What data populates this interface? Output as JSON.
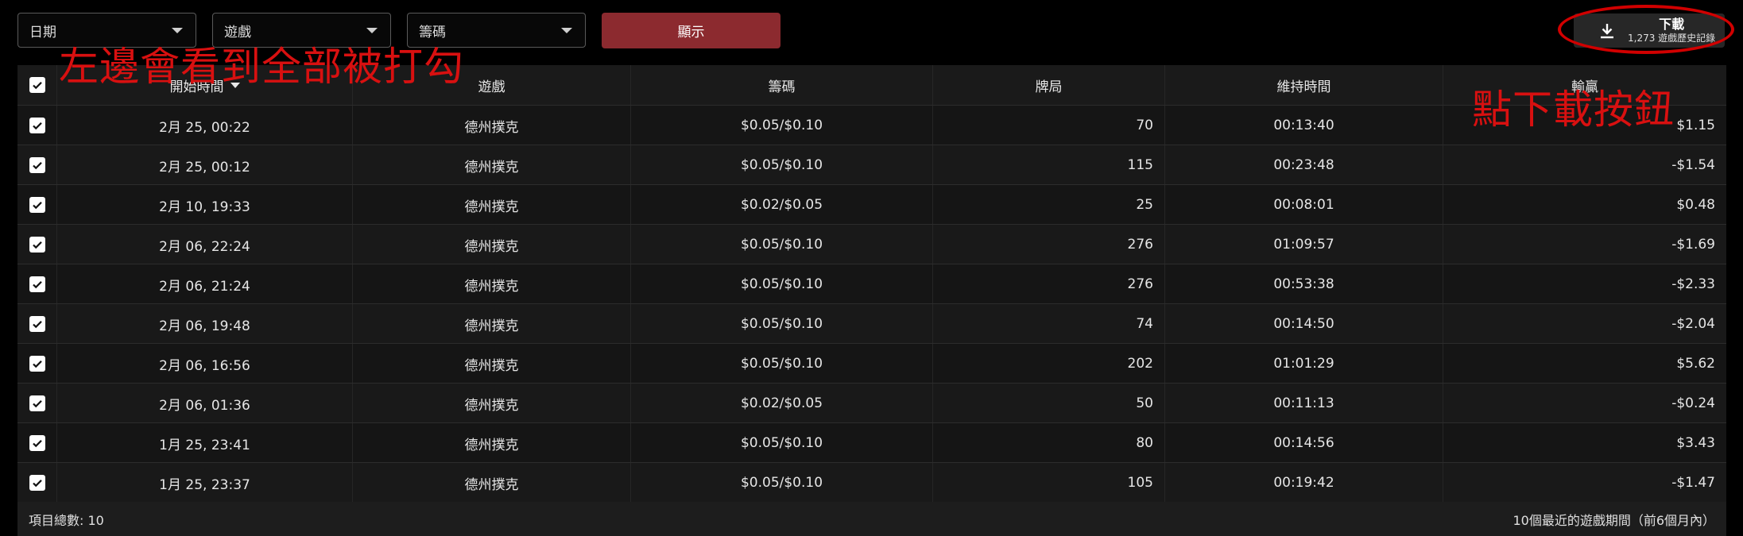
{
  "filters": {
    "date_label": "日期",
    "game_label": "遊戲",
    "stakes_label": "籌碼",
    "show_button": "顯示"
  },
  "download": {
    "title": "下載",
    "subtitle": "1,273 遊戲歷史記錄"
  },
  "annotations": {
    "left": "左邊會看到全部被打勾",
    "right": "點下載按鈕"
  },
  "table": {
    "headers": {
      "start_time": "開始時間",
      "game": "遊戲",
      "stakes": "籌碼",
      "hands": "牌局",
      "duration": "維持時間",
      "win_loss": "輸贏"
    },
    "rows": [
      {
        "start_time": "2月 25, 00:22",
        "game": "德州撲克",
        "stakes": "$0.05/$0.10",
        "hands": "70",
        "duration": "00:13:40",
        "win_loss": "$1.15"
      },
      {
        "start_time": "2月 25, 00:12",
        "game": "德州撲克",
        "stakes": "$0.05/$0.10",
        "hands": "115",
        "duration": "00:23:48",
        "win_loss": "-$1.54"
      },
      {
        "start_time": "2月 10, 19:33",
        "game": "德州撲克",
        "stakes": "$0.02/$0.05",
        "hands": "25",
        "duration": "00:08:01",
        "win_loss": "$0.48"
      },
      {
        "start_time": "2月 06, 22:24",
        "game": "德州撲克",
        "stakes": "$0.05/$0.10",
        "hands": "276",
        "duration": "01:09:57",
        "win_loss": "-$1.69"
      },
      {
        "start_time": "2月 06, 21:24",
        "game": "德州撲克",
        "stakes": "$0.05/$0.10",
        "hands": "276",
        "duration": "00:53:38",
        "win_loss": "-$2.33"
      },
      {
        "start_time": "2月 06, 19:48",
        "game": "德州撲克",
        "stakes": "$0.05/$0.10",
        "hands": "74",
        "duration": "00:14:50",
        "win_loss": "-$2.04"
      },
      {
        "start_time": "2月 06, 16:56",
        "game": "德州撲克",
        "stakes": "$0.05/$0.10",
        "hands": "202",
        "duration": "01:01:29",
        "win_loss": "$5.62"
      },
      {
        "start_time": "2月 06, 01:36",
        "game": "德州撲克",
        "stakes": "$0.02/$0.05",
        "hands": "50",
        "duration": "00:11:13",
        "win_loss": "-$0.24"
      },
      {
        "start_time": "1月 25, 23:41",
        "game": "德州撲克",
        "stakes": "$0.05/$0.10",
        "hands": "80",
        "duration": "00:14:56",
        "win_loss": "$3.43"
      },
      {
        "start_time": "1月 25, 23:37",
        "game": "德州撲克",
        "stakes": "$0.05/$0.10",
        "hands": "105",
        "duration": "00:19:42",
        "win_loss": "-$1.47"
      }
    ],
    "footer_total": "項目總數: 10",
    "footer_note": "10個最近的遊戲期間（前6個月內）"
  }
}
